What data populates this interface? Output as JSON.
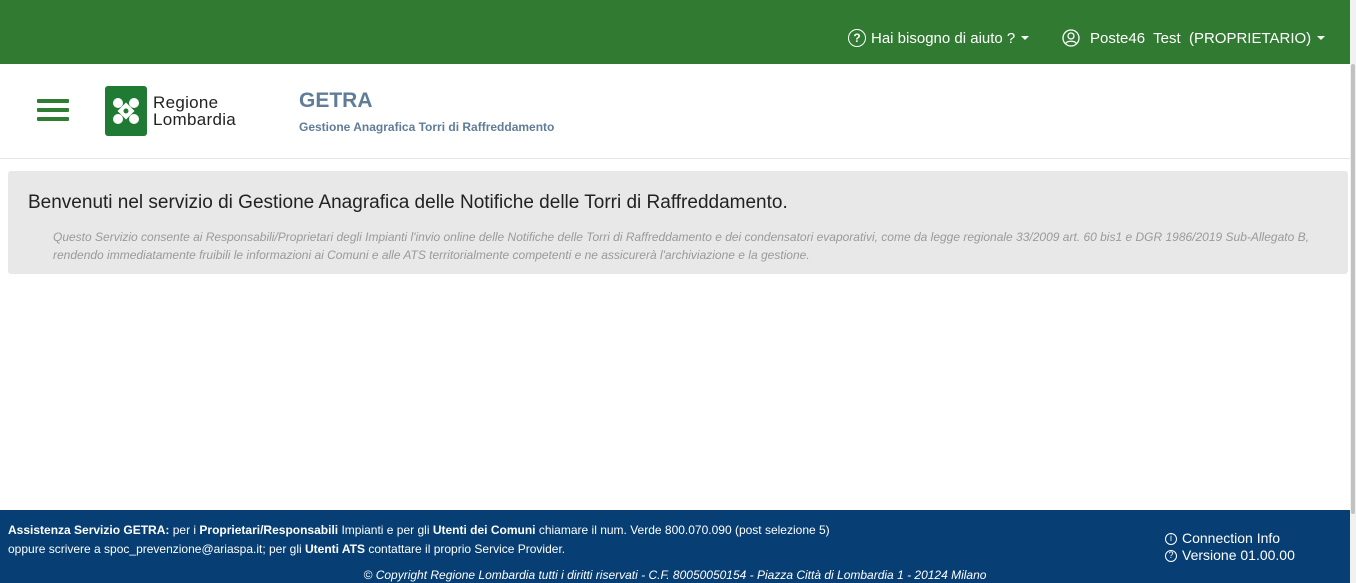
{
  "topbar": {
    "help_label": "Hai bisogno di aiuto ?",
    "user_label": "Poste46  Test  (PROPRIETARIO)"
  },
  "header": {
    "logo_line1": "Regione",
    "logo_line2": "Lombardia",
    "app_title": "GETRA",
    "app_subtitle": "Gestione Anagrafica Torri di Raffreddamento"
  },
  "welcome": {
    "title": "Benvenuti nel servizio di Gestione Anagrafica delle Notifiche delle Torri di Raffreddamento.",
    "description": "Questo Servizio consente ai Responsabili/Proprietari degli Impianti l'invio online delle Notifiche delle Torri di Raffreddamento e dei condensatori evaporativi, come da legge regionale 33/2009 art. 60 bis1 e DGR 1986/2019 Sub-Allegato B, rendendo immediatamente fruibili le informazioni ai Comuni e alle ATS territorialmente competenti e ne assicurerà l'archiviazione e la gestione."
  },
  "footer": {
    "assist_title": "Assistenza Servizio GETRA:",
    "assist_t1": " per i ",
    "assist_b1": "Proprietari/Responsabili",
    "assist_t2": " Impianti e per gli ",
    "assist_b2": "Utenti dei Comuni",
    "assist_t3": " chiamare il num. Verde 800.070.090 (post selezione 5)",
    "assist_t4": "oppure scrivere a spoc_prevenzione@ariaspa.it; per gli ",
    "assist_b3": "Utenti ATS",
    "assist_t5": " contattare il proprio Service Provider.",
    "connection_info": "Connection Info",
    "version": "Versione 01.00.00",
    "copyright": "© Copyright Regione Lombardia tutti i diritti riservati - C.F. 80050050154 - Piazza Città di Lombardia 1 - 20124 Milano"
  },
  "colors": {
    "topbar": "#317a32",
    "footer": "#073e73",
    "title": "#5f7d98"
  }
}
